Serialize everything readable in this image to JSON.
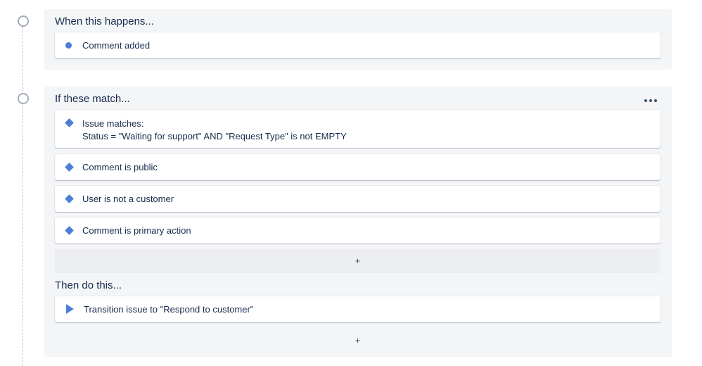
{
  "trigger": {
    "title": "When this happens...",
    "items": [
      {
        "icon": "dot-icon",
        "label": "Comment added"
      }
    ]
  },
  "conditions": {
    "title": "If these match...",
    "more_label": "•••",
    "items": [
      {
        "icon": "diamond-icon",
        "label": "Issue matches:",
        "detail": "Status = \"Waiting for support\" AND \"Request Type\" is not EMPTY"
      },
      {
        "icon": "diamond-icon",
        "label": "Comment is public"
      },
      {
        "icon": "diamond-icon",
        "label": "User is not a customer"
      },
      {
        "icon": "diamond-icon",
        "label": "Comment is primary action"
      }
    ],
    "add_label": "+"
  },
  "actions": {
    "title": "Then do this...",
    "items": [
      {
        "icon": "play-icon",
        "label": "Transition issue to \"Respond to customer\""
      }
    ],
    "add_label": "+"
  },
  "colors": {
    "accent": "#4a7fd6",
    "panel_bg": "#f4f5f7",
    "text": "#172b4d"
  }
}
